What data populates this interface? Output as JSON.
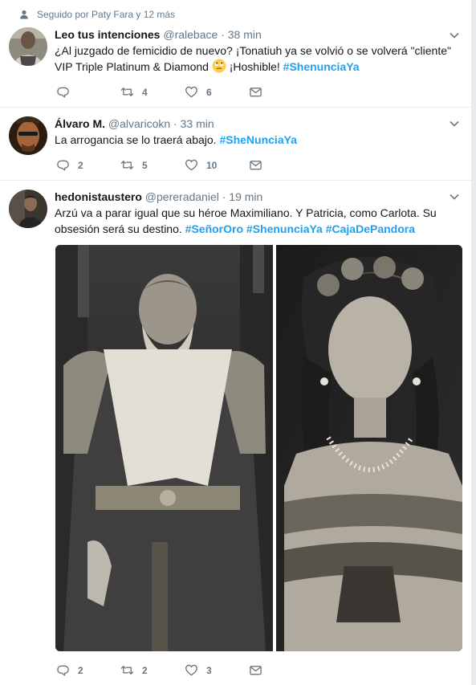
{
  "social_context": "Seguido por Paty Fara y 12 más",
  "tweets": [
    {
      "fullname": "Leo tus intenciones",
      "username": "@ralebace",
      "dot": "·",
      "time": "38 min",
      "text_part1": "¿Al juzgado de femicidio de nuevo? ¡Tonatiuh ya se volvió o se volverá \"cliente\" VIP Triple Platinum & Diamond ",
      "text_part2": " ¡Hoshible! ",
      "hashtags": [
        "#ShenunciaYa"
      ],
      "reply_count": "",
      "retweet_count": "4",
      "like_count": "6"
    },
    {
      "fullname": "Álvaro M.",
      "username": "@alvaricokn",
      "dot": "·",
      "time": "33 min",
      "text_part1": "La arrogancia se lo traerá abajo. ",
      "hashtags": [
        "#SheNunciaYa"
      ],
      "reply_count": "2",
      "retweet_count": "5",
      "like_count": "10"
    },
    {
      "fullname": "hedonistaustero",
      "username": "@pereradaniel",
      "dot": "·",
      "time": "19 min",
      "text_part1": "Arzú va a parar igual que su héroe Maximiliano. Y Patricia, como Carlota. Su obsesión será su destino. ",
      "hashtags": [
        "#SeñorOro",
        "#ShenunciaYa",
        "#CajaDePandora"
      ],
      "reply_count": "2",
      "retweet_count": "2",
      "like_count": "3"
    }
  ],
  "icons": {
    "person": "person-icon",
    "chevron": "chevron-down-icon",
    "reply": "reply-icon",
    "retweet": "retweet-icon",
    "like": "heart-icon",
    "dm": "envelope-icon",
    "emoji": "rolling-eyes-emoji"
  },
  "colors": {
    "hashtag": "#1da1f2",
    "secondary_text": "#657786",
    "divider": "#e6ecf0"
  }
}
